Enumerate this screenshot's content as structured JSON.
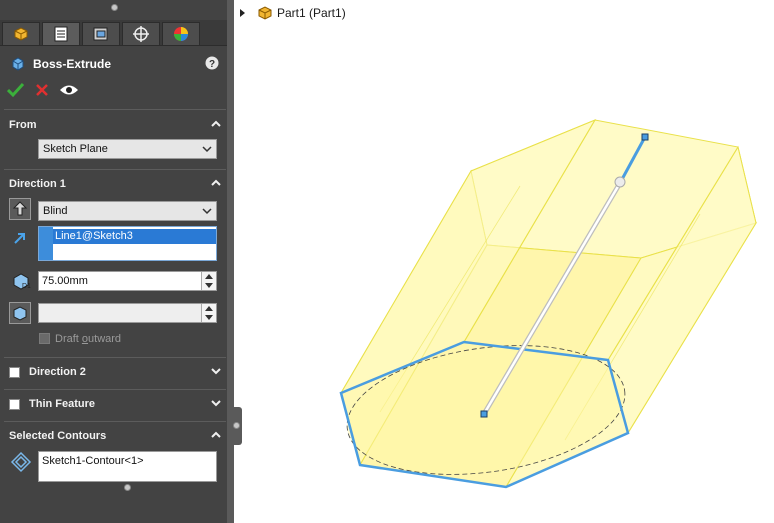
{
  "panel": {
    "title": "Boss-Extrude",
    "tabs": [
      "feature-manager-icon",
      "property-manager-icon",
      "configuration-manager-icon",
      "dimxpert-icon",
      "display-manager-icon"
    ],
    "actions": {
      "ok": "ok-check-icon",
      "cancel": "cancel-x-icon",
      "preview": "eye-preview-icon"
    },
    "from": {
      "header": "From",
      "value": "Sketch Plane"
    },
    "direction1": {
      "header": "Direction 1",
      "end_condition": "Blind",
      "direction_reference": "Line1@Sketch3",
      "depth": "75.00mm",
      "draft_value": "",
      "draft_outward_label": "Draft outward"
    },
    "direction2": {
      "header": "Direction 2"
    },
    "thin_feature": {
      "header": "Thin Feature"
    },
    "selected_contours": {
      "header": "Selected Contours",
      "item": "Sketch1-Contour<1>"
    }
  },
  "tree": {
    "root_label": "Part1 (Part1)"
  },
  "colors": {
    "panel_bg": "#434343",
    "selection_blue": "#2a7ad5",
    "preview_yellow": "#fff8b0",
    "sketch_blue": "#4a9de0"
  }
}
